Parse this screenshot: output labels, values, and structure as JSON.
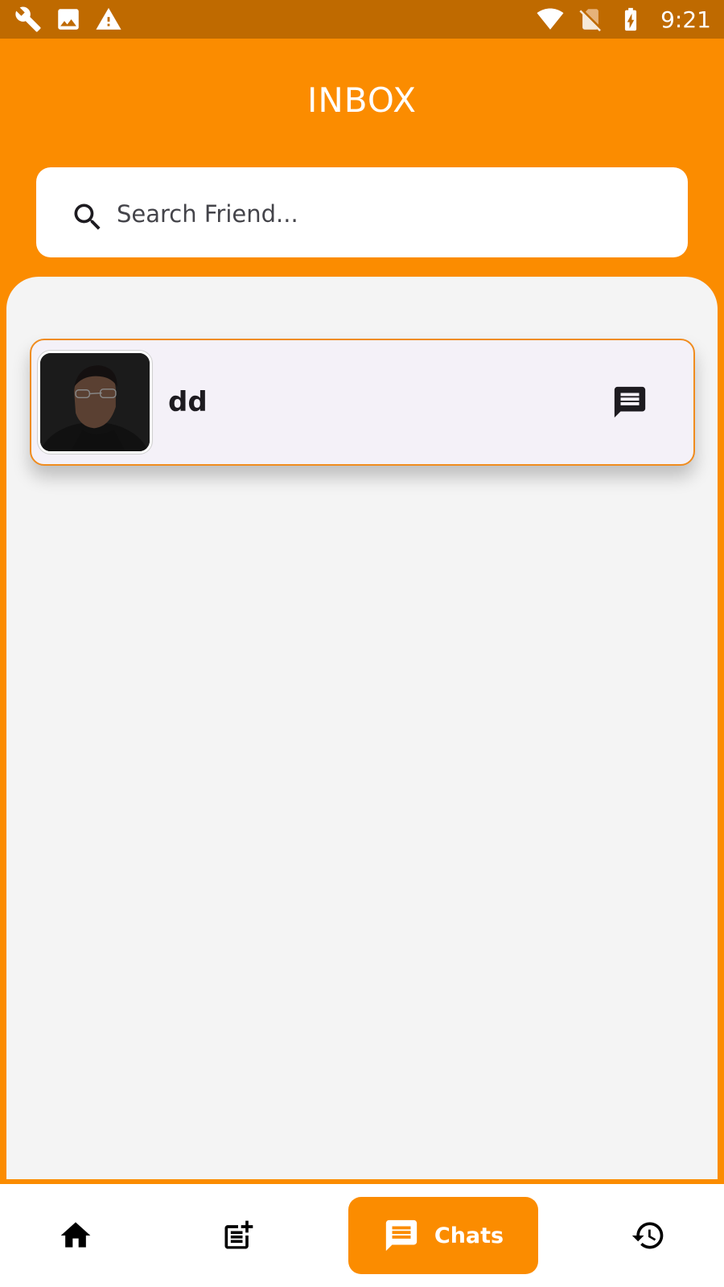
{
  "status_bar": {
    "time": "9:21",
    "left_icons": [
      "wrench-icon",
      "image-icon",
      "warning-icon"
    ],
    "right_icons": [
      "wifi-icon",
      "no-sim-icon",
      "battery-charging-icon"
    ]
  },
  "header": {
    "title": "INBOX"
  },
  "search": {
    "placeholder": "Search Friend...",
    "value": ""
  },
  "chats": [
    {
      "name": "dd",
      "avatar": "avatar-photo",
      "action_icon": "message-icon"
    }
  ],
  "bottom_nav": {
    "items": [
      {
        "icon": "home-icon",
        "label": "",
        "active": false
      },
      {
        "icon": "post-add-icon",
        "label": "",
        "active": false
      },
      {
        "icon": "chat-icon",
        "label": "Chats",
        "active": true
      },
      {
        "icon": "history-icon",
        "label": "",
        "active": false
      }
    ]
  },
  "colors": {
    "primary": "#fb8c00",
    "status_bar": "#bf6a00",
    "panel": "#f4f4f4",
    "card": "#f4f1f8",
    "card_border": "#f08c1e",
    "text_dark": "#1d1b20"
  }
}
